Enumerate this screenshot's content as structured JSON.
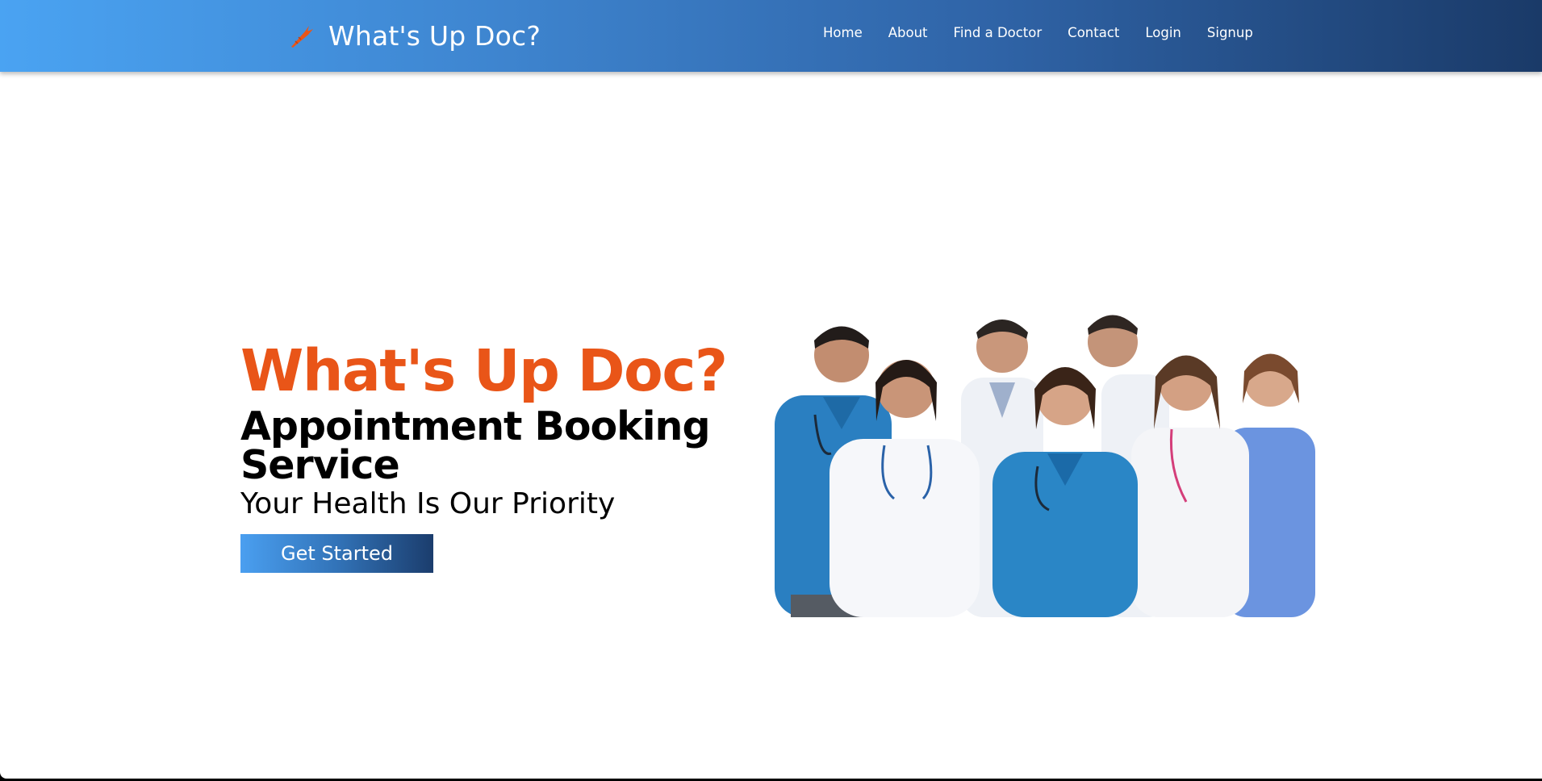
{
  "colors": {
    "accent": "#e95518",
    "header_gradient_start": "#4aa3f2",
    "header_gradient_end": "#1a3a68"
  },
  "header": {
    "brand_icon": "carrot-icon",
    "brand_title": "What's Up Doc?",
    "nav": [
      {
        "label": "Home"
      },
      {
        "label": "About"
      },
      {
        "label": "Find a Doctor"
      },
      {
        "label": "Contact"
      },
      {
        "label": "Login"
      },
      {
        "label": "Signup"
      }
    ]
  },
  "hero": {
    "title": "What's Up Doc?",
    "subtitle": "Appointment Booking Service",
    "tagline": "Your Health Is Our Priority",
    "cta_label": "Get Started",
    "image_icon": "doctors-group-photo"
  }
}
